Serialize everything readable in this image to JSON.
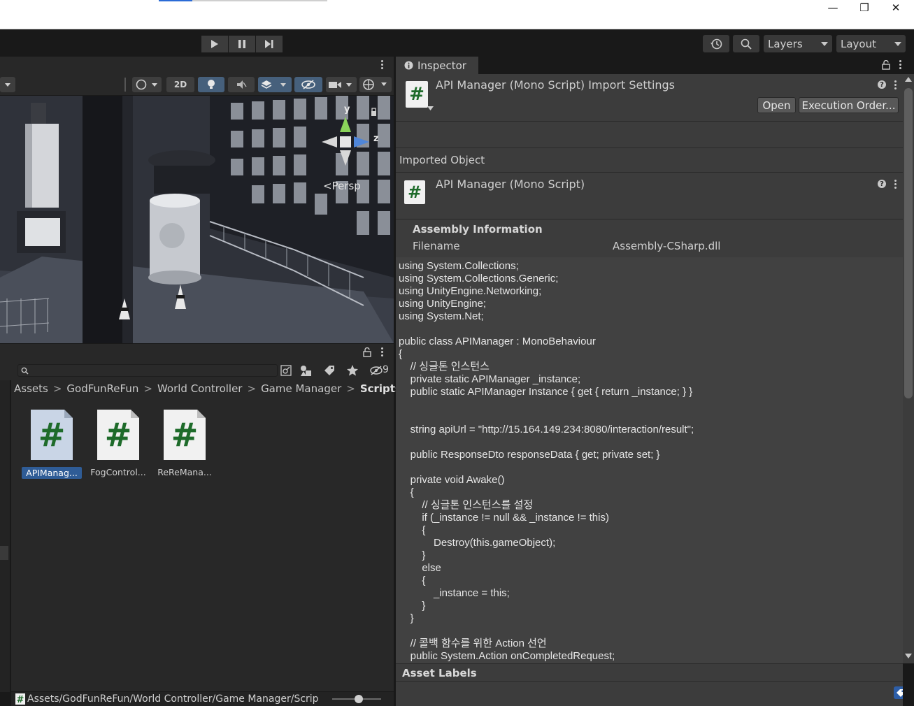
{
  "window": {
    "controls": {
      "minimize": "—",
      "restore": "❐",
      "close": "✕"
    }
  },
  "toolbar": {
    "layers_label": "Layers",
    "layout_label": "Layout"
  },
  "scene": {
    "toolbar_2d_label": "2D",
    "gizmo": {
      "y": "y",
      "z": "z",
      "persp": "<Persp"
    }
  },
  "project": {
    "hidden_count": "9",
    "breadcrumb": [
      "Assets",
      "GodFunReFun",
      "World Controller",
      "Game Manager",
      "Scripts"
    ],
    "assets": [
      {
        "name": "APIManag...",
        "selected": true
      },
      {
        "name": "FogControl...",
        "selected": false
      },
      {
        "name": "ReReMana...",
        "selected": false
      }
    ],
    "footer_path": "Assets/GodFunReFun/World Controller/Game Manager/Scrip"
  },
  "inspector": {
    "tab_label": "Inspector",
    "header_title": "API Manager (Mono Script) Import Settings",
    "open_button": "Open",
    "execution_order_button": "Execution Order...",
    "imported_object_label": "Imported Object",
    "imported_object_title": "API Manager (Mono Script)",
    "assembly_info_label": "Assembly Information",
    "filename_label": "Filename",
    "filename_value": "Assembly-CSharp.dll",
    "code": "using System.Collections;\nusing System.Collections.Generic;\nusing UnityEngine.Networking;\nusing UnityEngine;\nusing System.Net;\n\npublic class APIManager : MonoBehaviour\n{\n    // 싱글톤 인스턴스\n    private static APIManager _instance;\n    public static APIManager Instance { get { return _instance; } }\n\n\n    string apiUrl = \"http://15.164.149.234:8080/interaction/result\";\n\n    public ResponseDto responseData { get; private set; }\n\n    private void Awake()\n    {\n        // 싱글톤 인스턴스를 설정\n        if (_instance != null && _instance != this)\n        {\n            Destroy(this.gameObject);\n        }\n        else\n        {\n            _instance = this;\n        }\n    }\n\n    // 콜백 함수를 위한 Action 선언\n    public System.Action onCompletedRequest;",
    "asset_labels_label": "Asset Labels"
  }
}
